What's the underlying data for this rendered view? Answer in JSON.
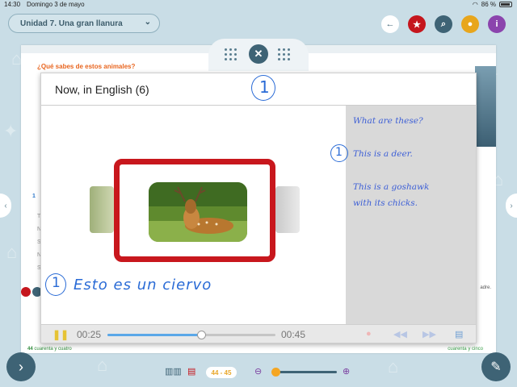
{
  "status": {
    "time": "14:30",
    "date": "Domingo 3 de mayo",
    "battery": "86 %"
  },
  "unit_selector": {
    "label": "Unidad 7. Una gran llanura"
  },
  "top_buttons": [
    {
      "icon": "back-arrow-icon",
      "color": "#ffffff",
      "glyph": "🡐"
    },
    {
      "icon": "star-icon",
      "color": "#c5161d",
      "glyph": "★"
    },
    {
      "icon": "search-icon",
      "color": "#3e6375",
      "glyph": "⌕"
    },
    {
      "icon": "lightbulb-icon",
      "color": "#e8a61c",
      "glyph": "💡"
    },
    {
      "icon": "info-icon",
      "color": "#8b44ad",
      "glyph": "i"
    }
  ],
  "book": {
    "question": "¿Qué sabes de estos animales?",
    "bullet_number": "1",
    "side_text": "adre.",
    "footer_left": "cuarenta y cuatro",
    "footer_left_page": "44",
    "footer_right": "cuarenta y cinco"
  },
  "modal": {
    "title": "Now, in English (6)",
    "header_annotation": "1",
    "answer_heading": "What are these?",
    "answer_number": "1",
    "answer_1": "This is a deer.",
    "answer_2_line1": "This is a goshawk",
    "answer_2_line2": "with its chicks.",
    "note_number": "1",
    "note_text": "Esto es un ciervo",
    "media": {
      "current_time": "00:25",
      "end_time": "00:45",
      "progress": 0.56
    }
  },
  "bottom": {
    "page_range": "44 - 45",
    "zoom_level": 0.0
  },
  "colors": {
    "accent": "#3e6375",
    "frame_red": "#c8171d",
    "handwriting": "#3d5fd6"
  }
}
